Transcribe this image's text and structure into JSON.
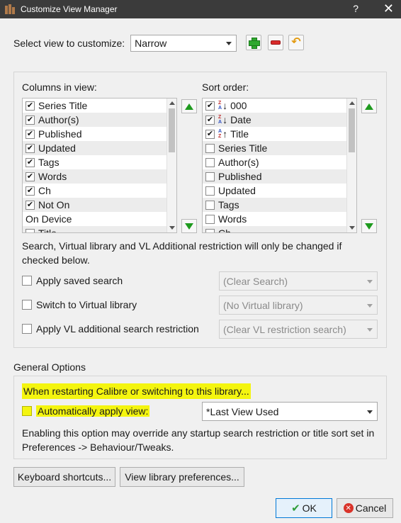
{
  "window": {
    "title": "Customize View Manager",
    "help": "?",
    "close": "✕"
  },
  "view_select": {
    "label": "Select view to customize:",
    "value": "Narrow",
    "add": "+",
    "remove": "−",
    "undo": "↶"
  },
  "columns": {
    "label": "Columns in view:",
    "items": [
      {
        "label": "Series Title",
        "checked": true
      },
      {
        "label": "Author(s)",
        "checked": true
      },
      {
        "label": "Published",
        "checked": true
      },
      {
        "label": "Updated",
        "checked": true
      },
      {
        "label": "Tags",
        "checked": true
      },
      {
        "label": "Words",
        "checked": true
      },
      {
        "label": "Ch",
        "checked": true
      },
      {
        "label": "Not On",
        "checked": true
      },
      {
        "label": "On Device",
        "checked": null
      },
      {
        "label": "Title",
        "checked": false
      }
    ]
  },
  "sort": {
    "label": "Sort order:",
    "items": [
      {
        "label": "000",
        "checked": true,
        "direction": "desc",
        "icon": "sort-descending-icon"
      },
      {
        "label": "Date",
        "checked": true,
        "direction": "desc",
        "icon": "sort-descending-icon"
      },
      {
        "label": "Title",
        "checked": true,
        "direction": "asc",
        "icon": "sort-ascending-icon"
      },
      {
        "label": "Series Title",
        "checked": false
      },
      {
        "label": "Author(s)",
        "checked": false
      },
      {
        "label": "Published",
        "checked": false
      },
      {
        "label": "Updated",
        "checked": false
      },
      {
        "label": "Tags",
        "checked": false
      },
      {
        "label": "Words",
        "checked": false
      },
      {
        "label": "Ch",
        "checked": false
      }
    ]
  },
  "restriction_note": "Search, Virtual library and VL Additional restriction will only be changed if checked below.",
  "restrictions": {
    "saved_search": {
      "label": "Apply saved search",
      "value": "(Clear Search)",
      "checked": false
    },
    "virtual_library": {
      "label": "Switch to Virtual library",
      "value": "(No Virtual library)",
      "checked": false
    },
    "vl_restriction": {
      "label": "Apply VL additional search restriction",
      "value": "(Clear VL restriction search)",
      "checked": false
    }
  },
  "general": {
    "title": "General Options",
    "restart_note": "When restarting Calibre or switching to this library...",
    "auto_apply_label": "Automatically apply view:",
    "auto_apply_value": "*Last View Used",
    "auto_apply_checked": false,
    "warning": "Enabling this option may override any startup search restriction or title sort set in Preferences -> Behaviour/Tweaks.",
    "highlight_color": "#f4f50f"
  },
  "buttons": {
    "keyboard_shortcuts": "Keyboard shortcuts...",
    "library_prefs": "View library preferences...",
    "ok": "OK",
    "cancel": "Cancel"
  }
}
